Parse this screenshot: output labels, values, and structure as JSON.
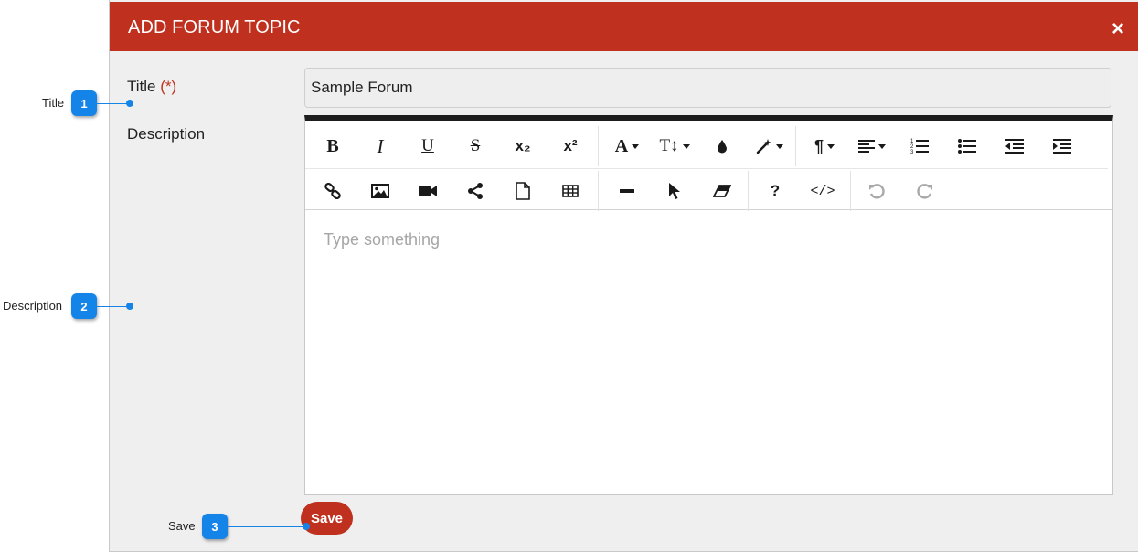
{
  "modal": {
    "title": "ADD FORUM TOPIC",
    "close_glyph": "×"
  },
  "form": {
    "title_label": "Title",
    "required_marker": "(*)",
    "title_value": "Sample Forum",
    "description_label": "Description",
    "description_placeholder": "Type something",
    "save_label": "Save"
  },
  "toolbar": {
    "row1": [
      {
        "name": "bold-icon",
        "glyph": "B"
      },
      {
        "name": "italic-icon",
        "glyph": "I"
      },
      {
        "name": "underline-icon",
        "glyph": "U"
      },
      {
        "name": "strikethrough-icon",
        "glyph": "S"
      },
      {
        "name": "subscript-icon",
        "glyph": "x₂"
      },
      {
        "name": "superscript-icon",
        "glyph": "x²"
      },
      {
        "name": "font-family-icon",
        "glyph": "A"
      },
      {
        "name": "font-size-icon",
        "glyph": "T↕"
      },
      {
        "name": "color-drop-icon"
      },
      {
        "name": "magic-wand-icon"
      },
      {
        "name": "paragraph-icon",
        "glyph": "¶"
      },
      {
        "name": "align-left-icon"
      },
      {
        "name": "ordered-list-icon"
      },
      {
        "name": "unordered-list-icon"
      },
      {
        "name": "outdent-icon"
      },
      {
        "name": "indent-icon"
      }
    ],
    "row2": [
      {
        "name": "link-icon"
      },
      {
        "name": "image-icon"
      },
      {
        "name": "video-icon"
      },
      {
        "name": "share-icon"
      },
      {
        "name": "document-icon"
      },
      {
        "name": "table-icon"
      },
      {
        "name": "horizontal-rule-icon"
      },
      {
        "name": "cursor-icon"
      },
      {
        "name": "eraser-icon"
      },
      {
        "name": "help-icon",
        "glyph": "?"
      },
      {
        "name": "code-view-icon",
        "glyph": "</>"
      },
      {
        "name": "undo-icon"
      },
      {
        "name": "redo-icon"
      }
    ]
  },
  "callouts": [
    {
      "label": "Title",
      "number": "1"
    },
    {
      "label": "Description",
      "number": "2"
    },
    {
      "label": "Save",
      "number": "3"
    }
  ],
  "colors": {
    "header": "#c0301e",
    "callout": "#1584e8",
    "required": "#c0301e"
  }
}
